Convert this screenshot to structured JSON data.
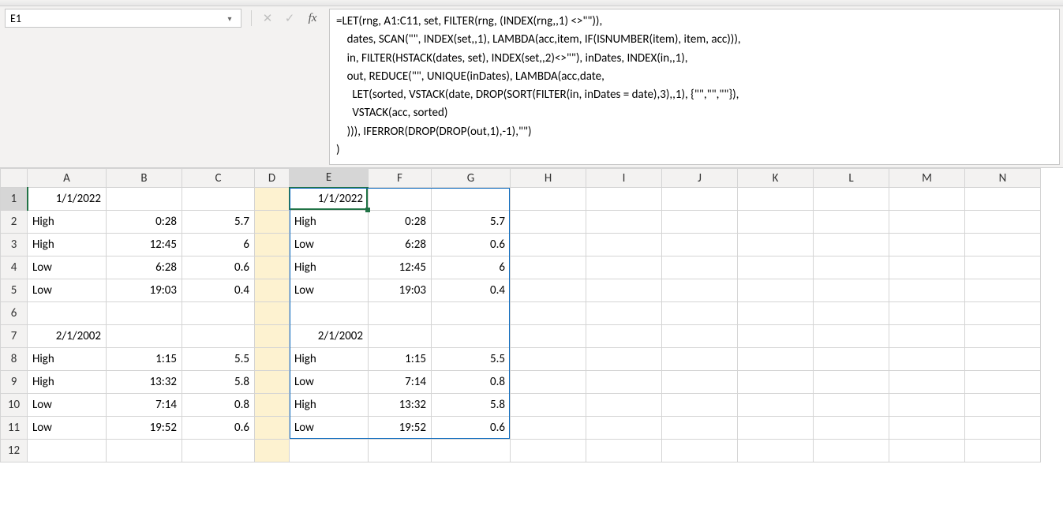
{
  "name_box": {
    "value": "E1"
  },
  "fb": {
    "cancel": "✕",
    "accept": "✓",
    "fx": "fx"
  },
  "formula_lines": [
    "=LET(rng, A1:C11, set, FILTER(rng, (INDEX(rng,,1) <>\"\")),",
    "    dates, SCAN(\"\", INDEX(set,,1), LAMBDA(acc,item, IF(ISNUMBER(item), item, acc))),",
    "    in, FILTER(HSTACK(dates, set), INDEX(set,,2)<>\"\"), inDates, INDEX(in,,1),",
    "    out, REDUCE(\"\", UNIQUE(inDates), LAMBDA(acc,date,",
    "      LET(sorted, VSTACK(date, DROP(SORT(FILTER(in, inDates = date),3),,1), {\"\",\"\",\"\"}),",
    "      VSTACK(acc, sorted)",
    "    ))), IFERROR(DROP(DROP(out,1),-1),\"\")",
    ")"
  ],
  "columns": [
    "A",
    "B",
    "C",
    "D",
    "E",
    "F",
    "G",
    "H",
    "I",
    "J",
    "K",
    "L",
    "M",
    "N"
  ],
  "col_classes": [
    "colA",
    "colB",
    "colC",
    "colD",
    "colE",
    "colF",
    "colG",
    "colRest",
    "colRest",
    "colRest",
    "colRest",
    "colRest",
    "colRest",
    "colRest"
  ],
  "rows": [
    {
      "n": "1",
      "cells": {
        "A": {
          "v": "1/1/2022",
          "a": "r"
        },
        "E": {
          "v": "1/1/2022",
          "a": "r"
        }
      }
    },
    {
      "n": "2",
      "cells": {
        "A": {
          "v": "High",
          "a": "l"
        },
        "B": {
          "v": "0:28",
          "a": "r"
        },
        "C": {
          "v": "5.7",
          "a": "r"
        },
        "E": {
          "v": "High",
          "a": "l"
        },
        "F": {
          "v": "0:28",
          "a": "r"
        },
        "G": {
          "v": "5.7",
          "a": "r"
        }
      }
    },
    {
      "n": "3",
      "cells": {
        "A": {
          "v": "High",
          "a": "l"
        },
        "B": {
          "v": "12:45",
          "a": "r"
        },
        "C": {
          "v": "6",
          "a": "r"
        },
        "E": {
          "v": "Low",
          "a": "l"
        },
        "F": {
          "v": "6:28",
          "a": "r"
        },
        "G": {
          "v": "0.6",
          "a": "r"
        }
      }
    },
    {
      "n": "4",
      "cells": {
        "A": {
          "v": "Low",
          "a": "l"
        },
        "B": {
          "v": "6:28",
          "a": "r"
        },
        "C": {
          "v": "0.6",
          "a": "r"
        },
        "E": {
          "v": "High",
          "a": "l"
        },
        "F": {
          "v": "12:45",
          "a": "r"
        },
        "G": {
          "v": "6",
          "a": "r"
        }
      }
    },
    {
      "n": "5",
      "cells": {
        "A": {
          "v": "Low",
          "a": "l"
        },
        "B": {
          "v": "19:03",
          "a": "r"
        },
        "C": {
          "v": "0.4",
          "a": "r"
        },
        "E": {
          "v": "Low",
          "a": "l"
        },
        "F": {
          "v": "19:03",
          "a": "r"
        },
        "G": {
          "v": "0.4",
          "a": "r"
        }
      }
    },
    {
      "n": "6",
      "cells": {}
    },
    {
      "n": "7",
      "cells": {
        "A": {
          "v": "2/1/2002",
          "a": "r"
        },
        "E": {
          "v": "2/1/2002",
          "a": "r"
        }
      }
    },
    {
      "n": "8",
      "cells": {
        "A": {
          "v": "High",
          "a": "l"
        },
        "B": {
          "v": "1:15",
          "a": "r"
        },
        "C": {
          "v": "5.5",
          "a": "r"
        },
        "E": {
          "v": "High",
          "a": "l"
        },
        "F": {
          "v": "1:15",
          "a": "r"
        },
        "G": {
          "v": "5.5",
          "a": "r"
        }
      }
    },
    {
      "n": "9",
      "cells": {
        "A": {
          "v": "High",
          "a": "l"
        },
        "B": {
          "v": "13:32",
          "a": "r"
        },
        "C": {
          "v": "5.8",
          "a": "r"
        },
        "E": {
          "v": "Low",
          "a": "l"
        },
        "F": {
          "v": "7:14",
          "a": "r"
        },
        "G": {
          "v": "0.8",
          "a": "r"
        }
      }
    },
    {
      "n": "10",
      "cells": {
        "A": {
          "v": "Low",
          "a": "l"
        },
        "B": {
          "v": "7:14",
          "a": "r"
        },
        "C": {
          "v": "0.8",
          "a": "r"
        },
        "E": {
          "v": "High",
          "a": "l"
        },
        "F": {
          "v": "13:32",
          "a": "r"
        },
        "G": {
          "v": "5.8",
          "a": "r"
        }
      }
    },
    {
      "n": "11",
      "cells": {
        "A": {
          "v": "Low",
          "a": "l"
        },
        "B": {
          "v": "19:52",
          "a": "r"
        },
        "C": {
          "v": "0.6",
          "a": "r"
        },
        "E": {
          "v": "Low",
          "a": "l"
        },
        "F": {
          "v": "19:52",
          "a": "r"
        },
        "G": {
          "v": "0.6",
          "a": "r"
        }
      }
    },
    {
      "n": "12",
      "cells": {}
    }
  ],
  "selected_cell": "E1",
  "highlight_col": "D",
  "spill_range": {
    "from": "E1",
    "to": "G11"
  }
}
